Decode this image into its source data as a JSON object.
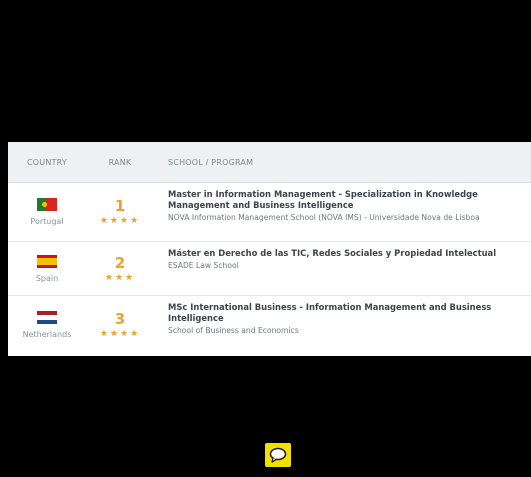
{
  "table": {
    "headers": {
      "country": "COUNTRY",
      "rank": "RANK",
      "program": "SCHOOL / PROGRAM"
    },
    "rows": [
      {
        "country": "Portugal",
        "flag_colors": [
          "#1f7a2e",
          "#d8261f"
        ],
        "rank": "1",
        "stars": "★★★★",
        "program": "Master in Information Management - Specialization in Knowledge Management and Business Intelligence",
        "school": "NOVA Information Management School (NOVA IMS) - Universidade Nova de Lisboa"
      },
      {
        "country": "Spain",
        "flag_colors": [
          "#c8161d",
          "#f3c300"
        ],
        "rank": "2",
        "stars": "★★★",
        "program": "Máster en Derecho de las TIC, Redes Sociales y Propiedad Intelectual",
        "school": "ESADE Law School"
      },
      {
        "country": "Netherlands",
        "flag_colors": [
          "#ae1c28",
          "#ffffff",
          "#21468b"
        ],
        "rank": "3",
        "stars": "★★★★",
        "program": "MSc International Business - Information Management and Business Intelligence",
        "school": "School of Business and Economics"
      }
    ]
  },
  "colors": {
    "accent": "#f0a12a",
    "chat_icon_bg": "#f1e000"
  },
  "icons": {
    "chat": "chat-bubble-icon"
  }
}
